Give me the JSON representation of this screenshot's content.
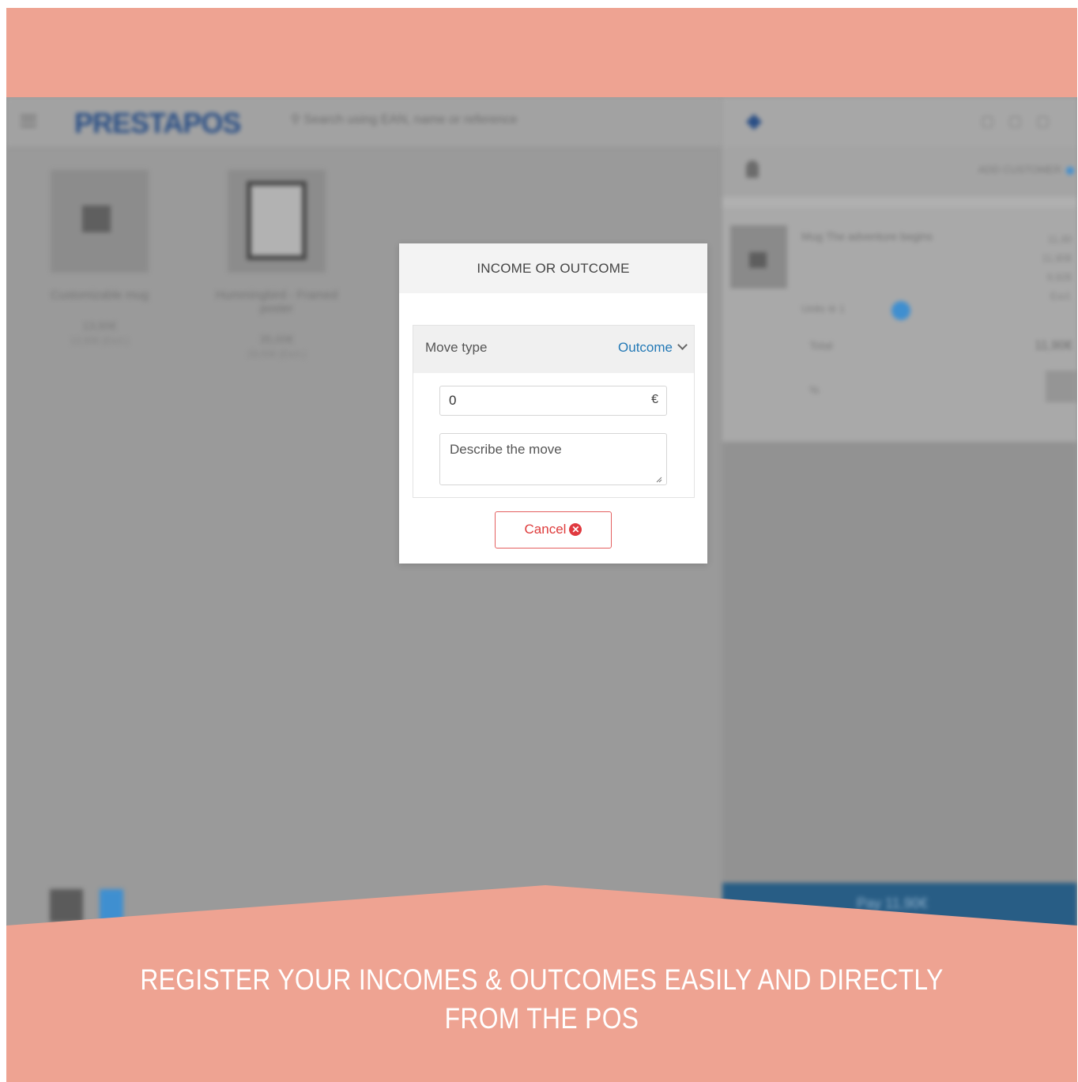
{
  "colors": {
    "banner": "#eea392",
    "accent": "#2379b6",
    "danger": "#de3b3b",
    "overlay": "#9a9a9a"
  },
  "app": {
    "logo": "PRESTAPOS",
    "search_placeholder": "Search using EAN, name or reference",
    "products": [
      {
        "name": "Customizable mug",
        "price": "13,90€",
        "sub": "13,90€ (Excl.)"
      },
      {
        "name": "Hummingbird - Framed poster",
        "price": "35,00€",
        "sub": "29,00€ (Excl.)"
      }
    ]
  },
  "cart": {
    "add_customer": "ADD CUSTOMER",
    "line_name": "Mug The adventure begins",
    "line_values": [
      "11,90",
      "11,90€",
      "9,92€ Excl."
    ],
    "qty_label": "Units",
    "qty_value": "1",
    "total_label": "Total",
    "total_value": "11,90€",
    "discount_label": "%",
    "pay_label": "Pay 11,90€"
  },
  "modal": {
    "title": "INCOME OR OUTCOME",
    "move_type_label": "Move type",
    "move_type_value": "Outcome",
    "amount_value": "0",
    "currency": "€",
    "description_placeholder": "Describe the move",
    "cancel_label": "Cancel",
    "cancel_icon": "close-circle-icon"
  },
  "caption": {
    "line1": "REGISTER YOUR INCOMES & OUTCOMES EASILY AND DIRECTLY",
    "line2": "FROM THE POS"
  }
}
